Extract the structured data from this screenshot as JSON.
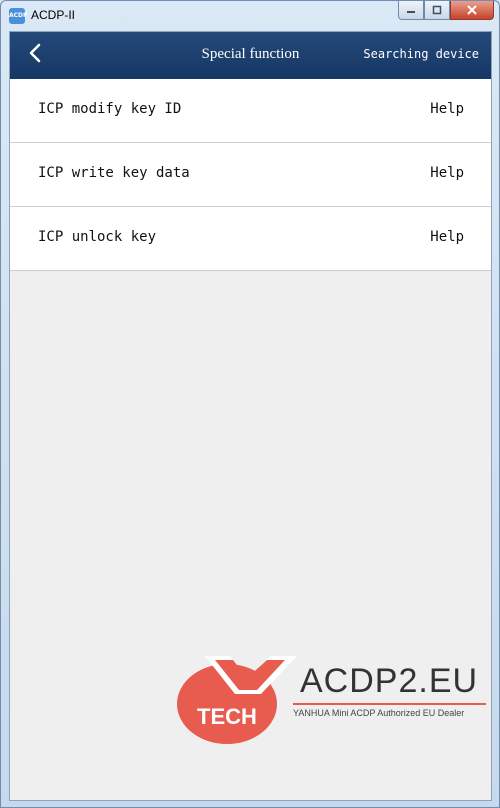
{
  "window": {
    "title": "ACDP-II",
    "icon": "app-icon",
    "controls": [
      "minimize-icon",
      "maximize-icon",
      "close-icon"
    ]
  },
  "header": {
    "title": "Special function",
    "status": "Searching device",
    "back_icon": "chevron-left-icon",
    "bg_color": "#1f4273"
  },
  "list": {
    "items": [
      {
        "label": "ICP modify key ID",
        "help": "Help"
      },
      {
        "label": "ICP write key data",
        "help": "Help"
      },
      {
        "label": "ICP unlock key",
        "help": "Help"
      }
    ]
  },
  "watermark": {
    "logo_text": "TECH",
    "brand": "ACDP2.EU",
    "tagline": "YANHUA Mini ACDP Authorized EU Dealer",
    "accent_color": "#e85b4f"
  }
}
